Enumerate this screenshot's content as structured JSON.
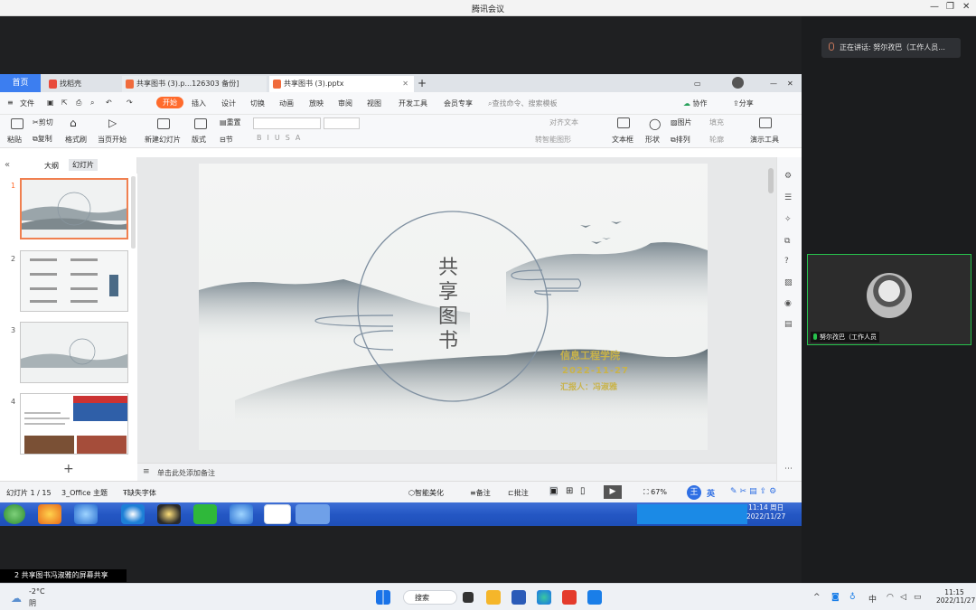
{
  "meeting_app": {
    "title": "腾讯会议",
    "speaking": "正在讲话: 努尔孜巴（工作人员...",
    "participant_name": "努尔孜巴（工作人员",
    "share_status": "2 共享图书冯淑雅的屏幕共享"
  },
  "wps": {
    "tabs": [
      "首页",
      "找稻壳",
      "共享图书 (3).p...126303 备份]",
      "共享图书 (3).pptx"
    ],
    "ribbon_tabs": [
      "文件",
      "开始",
      "插入",
      "设计",
      "切换",
      "动画",
      "放映",
      "审阅",
      "视图",
      "开发工具",
      "会员专享"
    ],
    "search_placeholder": "查找命令、搜索模板",
    "collab": "协作",
    "share": "分享",
    "tools": {
      "paste": "粘贴",
      "cut": "剪切",
      "copy": "复制",
      "format_painter": "格式刷",
      "play_from_start": "当页开始",
      "new_slide": "新建幻灯片",
      "layout": "版式",
      "section": "节",
      "reset": "重置",
      "align_text": "对齐文本",
      "smartart": "转智能图形",
      "textbox": "文本框",
      "shape": "形状",
      "arrange": "排列",
      "picture": "图片",
      "fill": "填充",
      "outline": "轮廓",
      "presenter": "演示工具"
    },
    "pane_tabs": [
      "大纲",
      "幻灯片"
    ],
    "slide_numbers": [
      "1",
      "2",
      "3",
      "4"
    ],
    "slide": {
      "title_chars": [
        "共",
        "享",
        "图",
        "书"
      ],
      "org": "信息工程学院",
      "date": "2022-11-27",
      "presenter": "汇报人：冯淑雅"
    },
    "notes_placeholder": "单击此处添加备注",
    "status": {
      "slide_count": "幻灯片 1 / 15",
      "theme": "3_Office 主题",
      "font_missing": "缺失字体",
      "smart_beautify": "智能美化",
      "notes": "备注",
      "comments": "批注",
      "zoom": "67%",
      "ime": "英"
    }
  },
  "xp_taskbar": {
    "time": "11:14 周日",
    "date": "2022/11/27"
  },
  "win_taskbar": {
    "temp": "-2°C",
    "weather": "阴",
    "search": "搜索",
    "ime": "中",
    "time": "11:15",
    "date": "2022/11/27"
  },
  "colors": {
    "accent": "#3c7ef0",
    "wps_orange": "#ff6b2c",
    "speaking_green": "#27c24c",
    "slide_gold": "#c9b34a"
  }
}
